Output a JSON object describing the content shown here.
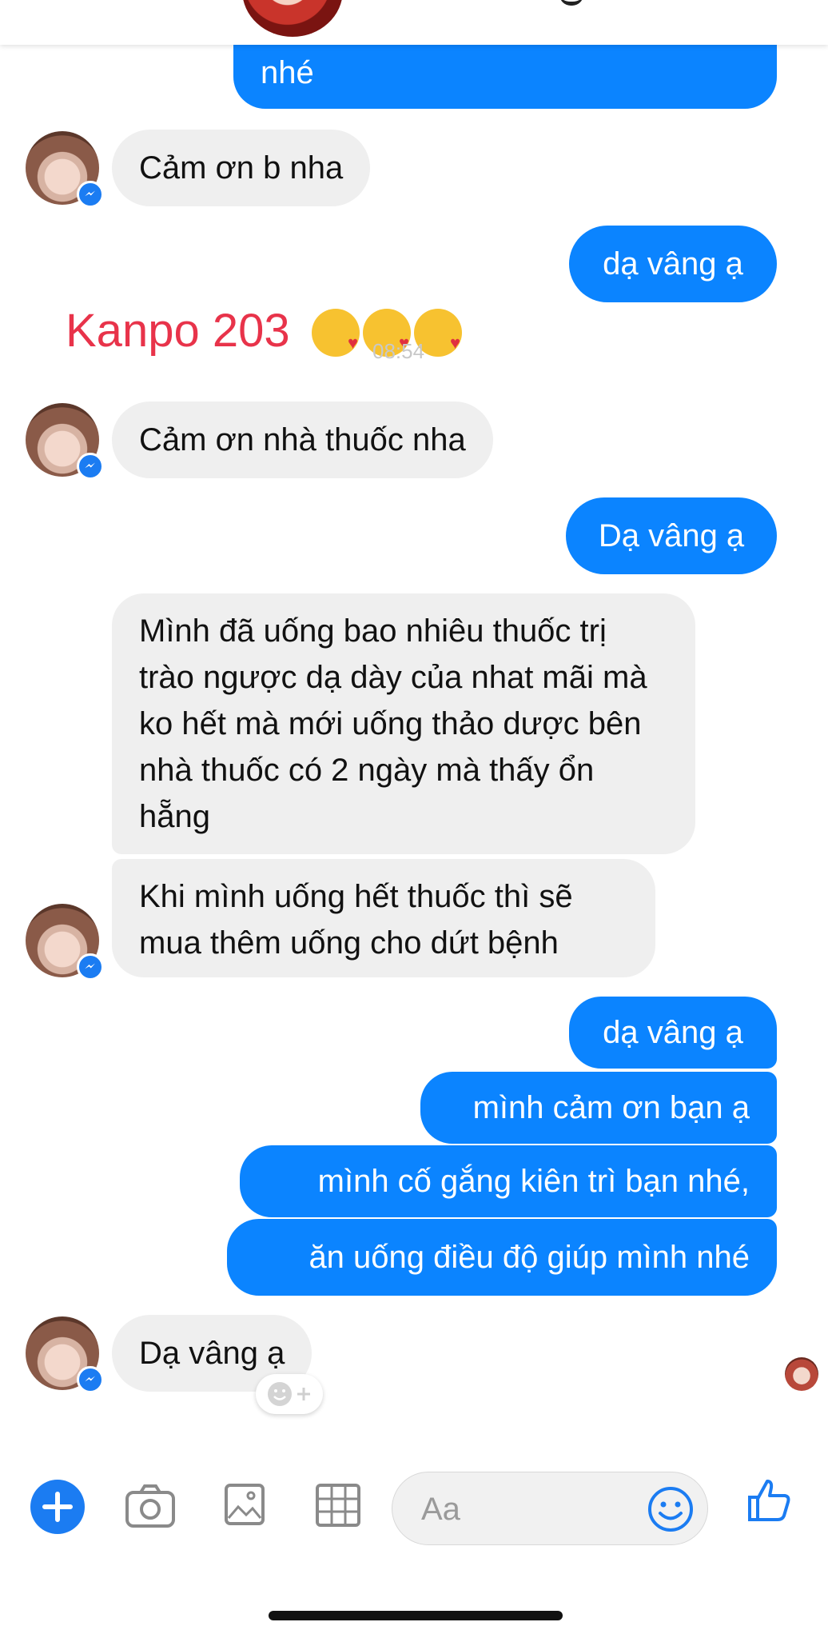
{
  "conversation": {
    "messages": [
      {
        "side": "out",
        "text": "nhé"
      },
      {
        "side": "in",
        "text": "Cảm ơn b nha"
      },
      {
        "side": "out",
        "text": "dạ vâng ạ"
      },
      {
        "side": "in",
        "text": "Cảm ơn nhà thuốc nha"
      },
      {
        "side": "out",
        "text": "Dạ vâng ạ"
      },
      {
        "side": "in",
        "text": "Mình đã uống bao nhiêu thuốc trị trào ngược dạ dày của nhat mãi mà ko hết mà mới uống thảo dược bên nhà thuốc có 2 ngày mà thấy ổn hẵng"
      },
      {
        "side": "in",
        "text": "Khi mình uống hết thuốc thì sẽ mua thêm uống cho dứt bệnh"
      },
      {
        "side": "out",
        "text": "dạ vâng ạ"
      },
      {
        "side": "out",
        "text": "mình cảm ơn bạn ạ"
      },
      {
        "side": "out",
        "text": "mình cố gắng kiên trì bạn nhé,"
      },
      {
        "side": "out",
        "text": "ăn uống điều độ giúp mình nhé"
      },
      {
        "side": "in",
        "text": "Dạ vâng ạ"
      }
    ],
    "overlay_caption": "Kanpo 203",
    "ghost_timestamp": "08:54"
  },
  "composer": {
    "input_placeholder": "Aa"
  },
  "colors": {
    "outgoing_bubble": "#0b84ff",
    "incoming_bubble": "#efefef",
    "accent": "#1b7cf2",
    "caption_red": "#e8334a"
  },
  "icons": {
    "composer": [
      "plus-icon",
      "camera-icon",
      "image-icon",
      "sticker-grid-icon",
      "emoji-icon",
      "like-icon"
    ],
    "avatar_badge": "messenger-icon"
  }
}
